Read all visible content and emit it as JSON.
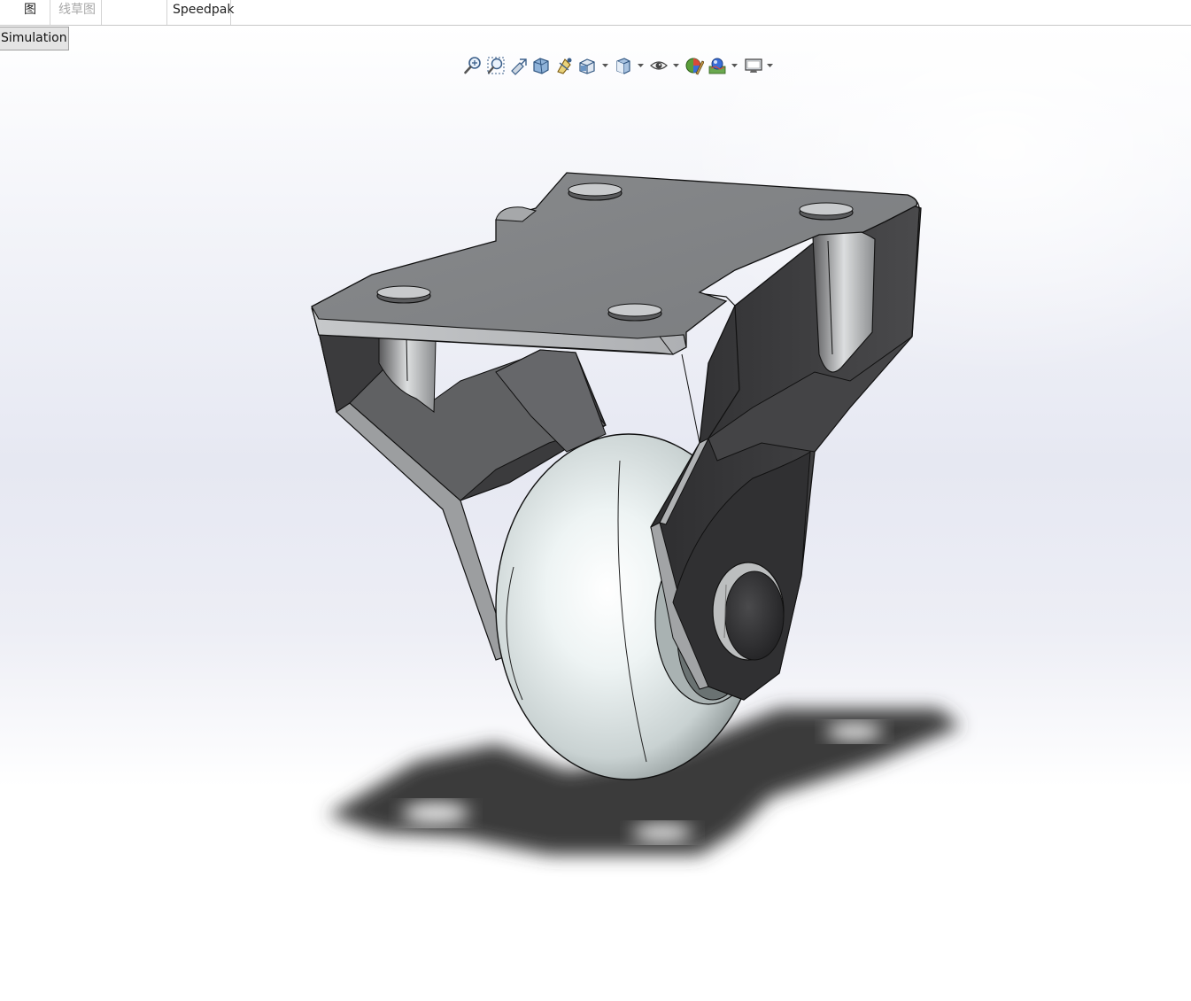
{
  "tabs": [
    {
      "label": "图",
      "state": "normal"
    },
    {
      "label": "线草图",
      "state": "disabled"
    },
    {
      "label": "",
      "state": "normal"
    },
    {
      "label": "Speedpak",
      "state": "normal"
    }
  ],
  "simulation_button": {
    "label": "Simulation"
  },
  "heads_up_toolbar": {
    "icons": [
      "zoom-to-fit-icon",
      "zoom-to-area-icon",
      "previous-view-icon",
      "section-view-icon",
      "dynamic-annotation-view-icon",
      "view-orientation-icon",
      "display-style-icon",
      "hide-show-items-icon",
      "edit-appearance-icon",
      "apply-scene-icon",
      "view-settings-icon"
    ]
  },
  "model": {
    "name": "caster-wheel-assembly",
    "colors": {
      "bracket_dark": "#3a3a3c",
      "bracket_top": "#8a8c8e",
      "wheel": "#dde6e6",
      "shadow": "#3c3c3c"
    }
  }
}
